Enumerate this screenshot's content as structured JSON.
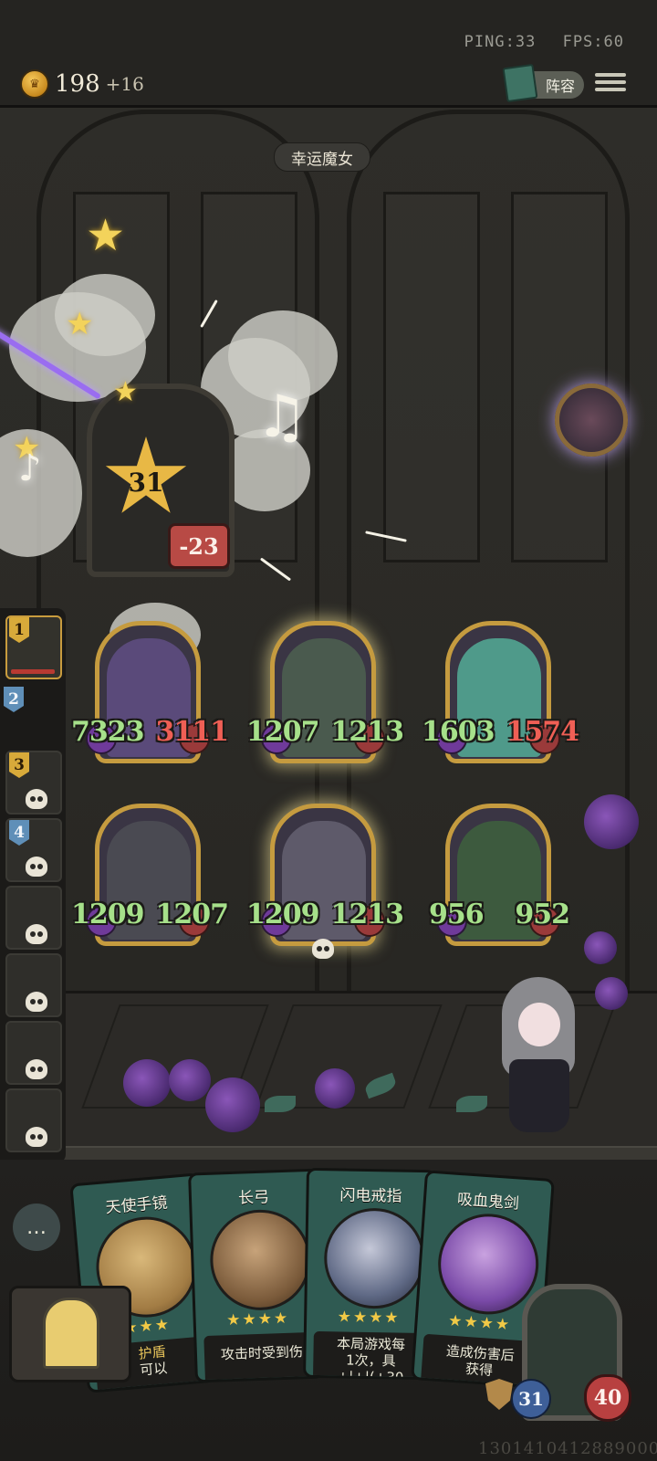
{
  "status": {
    "ping": "PING:33",
    "fps": "FPS:60"
  },
  "header": {
    "gold": "198",
    "gold_gain": "+16",
    "lineup_button": "阵容",
    "icons": {
      "coin": "crown-coin-icon",
      "lineup": "book-icon",
      "menu": "hamburger-menu-icon"
    }
  },
  "opponent": {
    "name": "幸运魔女",
    "level": "31",
    "damage_taken": "-23"
  },
  "sidebar": {
    "slots": [
      {
        "rank": "1",
        "active": true,
        "badge": "gold"
      },
      {
        "rank": "2",
        "active": false,
        "badge": "blue"
      },
      {
        "rank": "3",
        "active": false,
        "badge": "gold"
      },
      {
        "rank": "4",
        "active": false,
        "badge": "blue"
      },
      {
        "rank": "",
        "active": false,
        "badge": ""
      },
      {
        "rank": "",
        "active": false,
        "badge": ""
      },
      {
        "rank": "",
        "active": false,
        "badge": ""
      },
      {
        "rank": "",
        "active": false,
        "badge": ""
      }
    ]
  },
  "board": {
    "units": [
      {
        "atk": "7323",
        "hp": "3111",
        "hp_damaged": true,
        "color": "#5a4a7a"
      },
      {
        "atk": "1207",
        "hp": "1213",
        "hp_damaged": false,
        "color": "#4a5a4e"
      },
      {
        "atk": "1603",
        "hp": "1574",
        "hp_damaged": true,
        "color": "#4f9a8a"
      },
      {
        "atk": "1209",
        "hp": "1207",
        "hp_damaged": false,
        "color": "#4a4a52"
      },
      {
        "atk": "1209",
        "hp": "1213",
        "hp_damaged": false,
        "color": "#5e5a6a"
      },
      {
        "atk": "956",
        "hp": "952",
        "hp_damaged": false,
        "color": "#3d5a3e"
      }
    ]
  },
  "hand": {
    "cards": [
      {
        "title": "天使手镜",
        "stars": "★★★",
        "desc_lines": [
          "护盾",
          "可以"
        ]
      },
      {
        "title": "长弓",
        "stars": "★★★★",
        "desc_lines": [
          "攻击时受到伤"
        ]
      },
      {
        "title": "闪电戒指",
        "stars": "★★★★",
        "desc_lines": [
          "本局游戏每",
          "1次，具",
          "+|+|(+30"
        ]
      },
      {
        "title": "吸血鬼剑",
        "stars": "★★★★",
        "desc_lines": [
          "造成伤害后",
          "获得"
        ]
      }
    ]
  },
  "hero": {
    "atk": "31",
    "hp": "40"
  },
  "seed": "1301410412889000"
}
